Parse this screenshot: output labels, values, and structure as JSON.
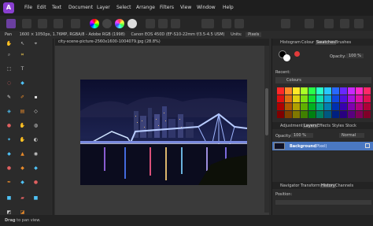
{
  "menu": {
    "items": [
      "File",
      "Edit",
      "Text",
      "Document",
      "Layer",
      "Select",
      "Arrange",
      "Filters",
      "View",
      "Window",
      "Help"
    ]
  },
  "context": {
    "tool": "Pan",
    "info": "1600 × 1050px, 1.76MP, RGBA/8 - Adobe RGB (1998)",
    "camera": "Canon EOS 450D (EF-S10-22mm f/3.5-4.5 USM)",
    "units_label": "Units:",
    "units_value": "Pixels"
  },
  "document": {
    "tab": "city-scene-picture-2560x1600-1004079.jpg (28.8%)"
  },
  "panel": {
    "top_tabs": [
      "Histogram",
      "Colour",
      "Swatches",
      "Brushes"
    ],
    "opacity_label": "Opacity:",
    "opacity_value": "100 %",
    "recent_label": "Recent:",
    "palette_name": "Colours",
    "layer_tabs": [
      "Adjustment",
      "Layers",
      "Effects",
      "Styles",
      "Stock"
    ],
    "layer_opacity_label": "Opacity:",
    "layer_opacity_value": "100 %",
    "blend_mode": "Normal",
    "layer_name": "Background",
    "layer_type": "(Pixel)",
    "bottom_tabs": [
      "Navigator",
      "Transform",
      "History",
      "Channels"
    ],
    "position_label": "Position:"
  },
  "status": {
    "bold": "Drag",
    "text": "to pan view."
  },
  "colors": {
    "accent": "#8a3fd1",
    "selection": "#4a78c2"
  }
}
